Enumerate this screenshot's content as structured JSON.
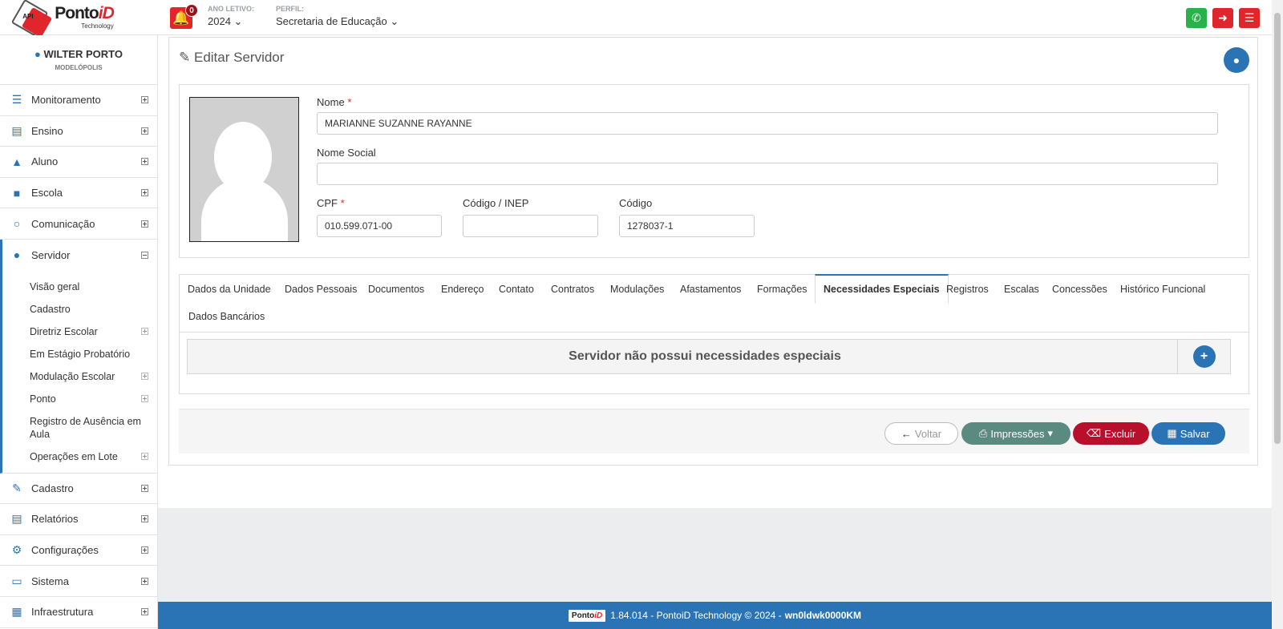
{
  "header": {
    "logo_brand": "Ponto",
    "logo_brand_accent": "iD",
    "logo_tagline": "Technology",
    "logo_api": "API",
    "notification_count": "0",
    "year_label": "ANO LETIVO:",
    "year_value": "2024",
    "profile_label": "PERFIL:",
    "profile_value": "Secretaria de Educação",
    "colors": {
      "whatsapp": "#2ab24a",
      "logout": "#e0262c",
      "menu": "#e0262c"
    }
  },
  "user": {
    "name": "WILTER PORTO",
    "city": "MODELÓPOLIS"
  },
  "sidebar": {
    "items_top": [
      {
        "label": "Monitoramento",
        "icon": "sliders-icon"
      },
      {
        "label": "Ensino",
        "icon": "book-icon"
      },
      {
        "label": "Aluno",
        "icon": "graduation-cap-icon"
      },
      {
        "label": "Escola",
        "icon": "institution-icon"
      },
      {
        "label": "Comunicação",
        "icon": "chat-bubble-icon"
      }
    ],
    "active": {
      "label": "Servidor",
      "icon": "user-icon"
    },
    "submenu": [
      {
        "label": "Visão geral",
        "expandable": false
      },
      {
        "label": "Cadastro",
        "expandable": false
      },
      {
        "label": "Diretriz Escolar",
        "expandable": true
      },
      {
        "label": "Em Estágio Probatório",
        "expandable": false
      },
      {
        "label": "Modulação Escolar",
        "expandable": true
      },
      {
        "label": "Ponto",
        "expandable": true
      },
      {
        "label": "Registro de Ausência em Aula",
        "expandable": false
      },
      {
        "label": "Operações em Lote",
        "expandable": true
      }
    ],
    "items_bottom": [
      {
        "label": "Cadastro",
        "icon": "edit-icon"
      },
      {
        "label": "Relatórios",
        "icon": "report-icon"
      },
      {
        "label": "Configurações",
        "icon": "gear-icon"
      },
      {
        "label": "Sistema",
        "icon": "monitor-icon"
      },
      {
        "label": "Infraestrutura",
        "icon": "building-icon"
      }
    ]
  },
  "panel": {
    "title": "Editar Servidor",
    "form": {
      "nome_label": "Nome",
      "nome_value": "MARIANNE SUZANNE RAYANNE",
      "nome_social_label": "Nome Social",
      "nome_social_value": "",
      "cpf_label": "CPF",
      "cpf_value": "010.599.071-00",
      "inep_label": "Código / INEP",
      "inep_value": "",
      "codigo_label": "Código",
      "codigo_value": "1278037-1",
      "required_mark": "*"
    },
    "tabs": [
      "Dados da Unidade",
      "Dados Pessoais",
      "Documentos",
      "Endereço",
      "Contato",
      "Contratos",
      "Modulações",
      "Afastamentos",
      "Formações",
      "Necessidades Especiais",
      "Registros",
      "Escalas",
      "Concessões",
      "Histórico Funcional",
      "Dados Bancários"
    ],
    "active_tab": "Necessidades Especiais",
    "empty_message": "Servidor não possui necessidades especiais",
    "actions": {
      "back": "Voltar",
      "print": "Impressões",
      "delete": "Excluir",
      "save": "Salvar"
    }
  },
  "footer": {
    "logo_brand": "Ponto",
    "logo_accent": "iD",
    "text": "1.84.014 - PontoiD Technology © 2024 -",
    "host": "wn0ldwk0000KM"
  }
}
